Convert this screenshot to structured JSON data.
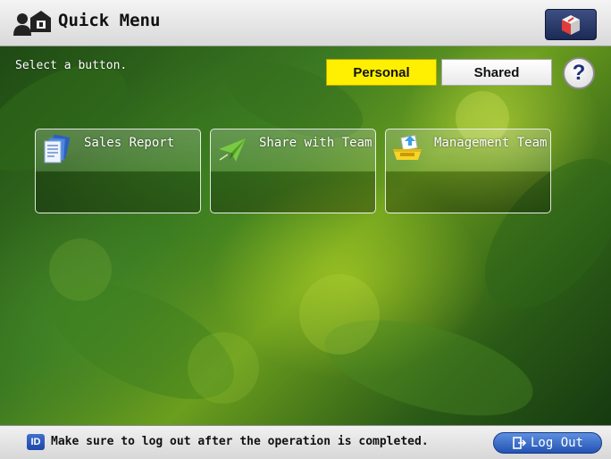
{
  "header": {
    "title": "Quick Menu"
  },
  "main": {
    "prompt": "Select a button.",
    "tabs": [
      {
        "label": "Personal",
        "selected": true
      },
      {
        "label": "Shared",
        "selected": false
      }
    ],
    "help_label": "?",
    "buttons": [
      {
        "label": "Sales Report",
        "icon": "document-stack-icon"
      },
      {
        "label": "Share with Team",
        "icon": "paper-plane-icon"
      },
      {
        "label": "Management Team",
        "icon": "inbox-tray-icon"
      }
    ]
  },
  "footer": {
    "id_badge": "ID",
    "message": "Make sure to log out after the operation is completed.",
    "logout_label": "Log Out"
  },
  "colors": {
    "selected_tab": "#ffef00",
    "logout_button": "#2453b3",
    "cube_button": "#1b2a55"
  }
}
